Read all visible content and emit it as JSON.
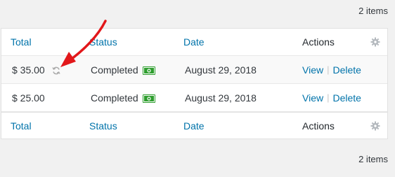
{
  "item_count": "2 items",
  "columns": {
    "total": "Total",
    "status": "Status",
    "date": "Date",
    "actions": "Actions"
  },
  "rows": [
    {
      "total": "$ 35.00",
      "status": "Completed",
      "date": "August 29, 2018",
      "view": "View",
      "delete": "Delete",
      "recurring": true
    },
    {
      "total": "$ 25.00",
      "status": "Completed",
      "date": "August 29, 2018",
      "view": "View",
      "delete": "Delete",
      "recurring": false
    }
  ],
  "colors": {
    "link": "#0073aa",
    "money_green": "#2e9e2e",
    "annotation_red": "#e2171a",
    "icon_gray": "#aaaaaa"
  },
  "icons": {
    "gear": "gear-icon",
    "money": "money-icon",
    "refresh": "refresh-icon",
    "annotation": "red-arrow-annotation"
  }
}
